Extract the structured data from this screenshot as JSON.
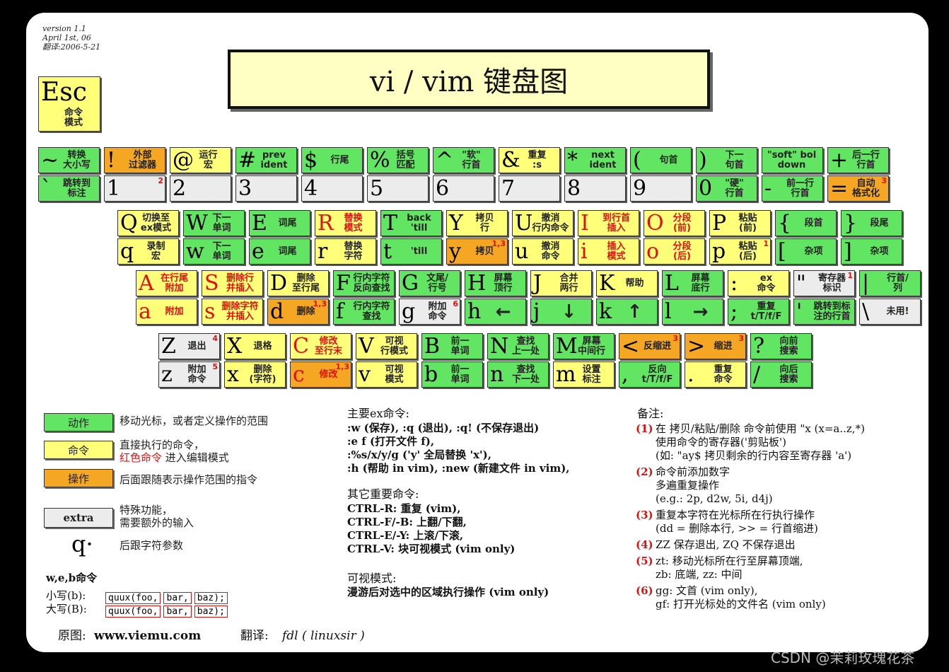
{
  "meta": {
    "version": "version 1.1",
    "date": "April 1st, 06",
    "translated": "翻译:2006-5-21"
  },
  "title": "vi / vim 键盘图",
  "esc": {
    "char": "Esc",
    "desc": "命令\n模式"
  },
  "rows": [
    [
      {
        "up": {
          "c": "~",
          "d": "转换\n大小写",
          "k": "g"
        },
        "dn": {
          "c": "`",
          "d": "跳转到\n标注",
          "k": "g"
        }
      },
      {
        "up": {
          "c": "!",
          "d": "外部\n过滤器",
          "k": "o"
        },
        "dn": {
          "c": "1",
          "d": "",
          "k": "x",
          "n": "2"
        }
      },
      {
        "up": {
          "c": "@",
          "d": "运行\n宏",
          "k": "y"
        },
        "dn": {
          "c": "2",
          "d": "",
          "k": "x"
        }
      },
      {
        "up": {
          "c": "#",
          "d": "prev\nident",
          "k": "g"
        },
        "dn": {
          "c": "3",
          "d": "",
          "k": "x"
        }
      },
      {
        "up": {
          "c": "$",
          "d": "行尾",
          "k": "g"
        },
        "dn": {
          "c": "4",
          "d": "",
          "k": "x"
        }
      },
      {
        "up": {
          "c": "%",
          "d": "括号\n匹配",
          "k": "g"
        },
        "dn": {
          "c": "5",
          "d": "",
          "k": "x"
        }
      },
      {
        "up": {
          "c": "^",
          "d": "\"软\"\n行首",
          "k": "g"
        },
        "dn": {
          "c": "6",
          "d": "",
          "k": "x"
        }
      },
      {
        "up": {
          "c": "&",
          "d": "重复\n:s",
          "k": "y"
        },
        "dn": {
          "c": "7",
          "d": "",
          "k": "x"
        }
      },
      {
        "up": {
          "c": "*",
          "d": "next\nident",
          "k": "g"
        },
        "dn": {
          "c": "8",
          "d": "",
          "k": "x"
        }
      },
      {
        "up": {
          "c": "(",
          "d": "句首",
          "k": "g"
        },
        "dn": {
          "c": "9",
          "d": "",
          "k": "x"
        }
      },
      {
        "up": {
          "c": ")",
          "d": "下一\n句首",
          "k": "g"
        },
        "dn": {
          "c": "0",
          "d": "\"硬\"\n行首",
          "k": "g"
        }
      },
      {
        "up": {
          "c": "",
          "d": "\"soft\" bol\ndown",
          "k": "g"
        },
        "dn": {
          "c": "-",
          "d": "前一行\n行首",
          "k": "g"
        }
      },
      {
        "up": {
          "c": "+",
          "d": "后一行\n行首",
          "k": "g"
        },
        "dn": {
          "c": "=",
          "d": "自动\n格式化",
          "k": "o",
          "n": "3"
        }
      }
    ],
    [
      {
        "up": {
          "c": "Q",
          "d": "切换至\nex模式",
          "k": "y"
        },
        "dn": {
          "c": "q",
          "d": "录制\n宏",
          "k": "y"
        }
      },
      {
        "up": {
          "c": "W",
          "d": "下一\n单词",
          "k": "g"
        },
        "dn": {
          "c": "w",
          "d": "下一\n单词",
          "k": "g"
        }
      },
      {
        "up": {
          "c": "E",
          "d": "词尾",
          "k": "g"
        },
        "dn": {
          "c": "e",
          "d": "词尾",
          "k": "g"
        }
      },
      {
        "up": {
          "c": "R",
          "d": "替换\n模式",
          "k": "y",
          "r": true
        },
        "dn": {
          "c": "r",
          "d": "替换\n字符",
          "k": "y"
        }
      },
      {
        "up": {
          "c": "T",
          "d": "back\n'till",
          "k": "g"
        },
        "dn": {
          "c": "t",
          "d": "'till",
          "k": "g"
        }
      },
      {
        "up": {
          "c": "Y",
          "d": "拷贝\n行",
          "k": "y"
        },
        "dn": {
          "c": "y",
          "d": "拷贝",
          "k": "o",
          "n": "1,3"
        }
      },
      {
        "up": {
          "c": "U",
          "d": "撤消\n行内命令",
          "k": "y"
        },
        "dn": {
          "c": "u",
          "d": "撤消\n命令",
          "k": "y"
        }
      },
      {
        "up": {
          "c": "I",
          "d": "到行首\n插入",
          "k": "y",
          "r": true
        },
        "dn": {
          "c": "i",
          "d": "插入\n模式",
          "k": "y",
          "r": true
        }
      },
      {
        "up": {
          "c": "O",
          "d": "分段\n(前)",
          "k": "y",
          "r": true
        },
        "dn": {
          "c": "o",
          "d": "分段\n(后)",
          "k": "y",
          "r": true
        }
      },
      {
        "up": {
          "c": "P",
          "d": "粘贴\n(前)",
          "k": "y"
        },
        "dn": {
          "c": "p",
          "d": "粘贴\n(后)",
          "k": "y",
          "n": "1"
        }
      },
      {
        "up": {
          "c": "{",
          "d": "段首",
          "k": "g"
        },
        "dn": {
          "c": "[",
          "d": "杂项",
          "k": "g"
        }
      },
      {
        "up": {
          "c": "}",
          "d": "段尾",
          "k": "g"
        },
        "dn": {
          "c": "]",
          "d": "杂项",
          "k": "g"
        }
      }
    ],
    [
      {
        "up": {
          "c": "A",
          "d": "在行尾\n附加",
          "k": "y",
          "r": true
        },
        "dn": {
          "c": "a",
          "d": "附加",
          "k": "y",
          "r": true
        }
      },
      {
        "up": {
          "c": "S",
          "d": "删除行\n并插入",
          "k": "y",
          "r": true
        },
        "dn": {
          "c": "s",
          "d": "删除字符\n并插入",
          "k": "y",
          "r": true
        }
      },
      {
        "up": {
          "c": "D",
          "d": "删除\n至行尾",
          "k": "y"
        },
        "dn": {
          "c": "d",
          "d": "删除",
          "k": "o",
          "n": "1,3"
        }
      },
      {
        "up": {
          "c": "F",
          "d": "行内字符\n反向查找",
          "k": "g"
        },
        "dn": {
          "c": "f",
          "d": "行内字符\n查找",
          "k": "g"
        }
      },
      {
        "up": {
          "c": "G",
          "d": "文尾/\n行号",
          "k": "g"
        },
        "dn": {
          "c": "g",
          "d": "附加\n命令",
          "k": "x",
          "n": "6"
        }
      },
      {
        "up": {
          "c": "H",
          "d": "屏幕\n顶行",
          "k": "g"
        },
        "dn": {
          "c": "h",
          "d": "←",
          "k": "g"
        }
      },
      {
        "up": {
          "c": "J",
          "d": "合并\n两行",
          "k": "y"
        },
        "dn": {
          "c": "j",
          "d": "↓",
          "k": "g"
        }
      },
      {
        "up": {
          "c": "K",
          "d": "帮助",
          "k": "y"
        },
        "dn": {
          "c": "k",
          "d": "↑",
          "k": "g"
        }
      },
      {
        "up": {
          "c": "L",
          "d": "屏幕\n底行",
          "k": "g"
        },
        "dn": {
          "c": "l",
          "d": "→",
          "k": "g"
        }
      },
      {
        "up": {
          "c": ":",
          "d": "ex\n命令",
          "k": "y"
        },
        "dn": {
          "c": ";",
          "d": "重复\nt/T/f/F",
          "k": "g"
        }
      },
      {
        "up": {
          "c": "\"",
          "d": "寄存器\n标识",
          "k": "x",
          "n": "1"
        },
        "dn": {
          "c": "'",
          "d": "跳转到标\n注的行首",
          "k": "g"
        }
      },
      {
        "up": {
          "c": "|",
          "d": "行首/\n列",
          "k": "g"
        },
        "dn": {
          "c": "\\",
          "d": "未用!",
          "k": "x"
        }
      }
    ],
    [
      {
        "up": {
          "c": "Z",
          "d": "退出",
          "k": "x",
          "n": "4"
        },
        "dn": {
          "c": "z",
          "d": "附加\n命令",
          "k": "x",
          "n": "5"
        }
      },
      {
        "up": {
          "c": "X",
          "d": "退格",
          "k": "y"
        },
        "dn": {
          "c": "x",
          "d": "删除\n(字符)",
          "k": "y"
        }
      },
      {
        "up": {
          "c": "C",
          "d": "修改\n至行末",
          "k": "y",
          "r": true
        },
        "dn": {
          "c": "c",
          "d": "修改",
          "k": "o",
          "r": true,
          "n": "1,3"
        }
      },
      {
        "up": {
          "c": "V",
          "d": "可视\n行模式",
          "k": "y"
        },
        "dn": {
          "c": "v",
          "d": "可视\n模式",
          "k": "y"
        }
      },
      {
        "up": {
          "c": "B",
          "d": "前一\n单词",
          "k": "g"
        },
        "dn": {
          "c": "b",
          "d": "前一\n单词",
          "k": "g"
        }
      },
      {
        "up": {
          "c": "N",
          "d": "查找\n上一处",
          "k": "g"
        },
        "dn": {
          "c": "n",
          "d": "查找\n下一处",
          "k": "g"
        }
      },
      {
        "up": {
          "c": "M",
          "d": "屏幕\n中间行",
          "k": "g"
        },
        "dn": {
          "c": "m",
          "d": "设置\n标注",
          "k": "y"
        }
      },
      {
        "up": {
          "c": "<",
          "d": "反缩进",
          "k": "o",
          "n": "3"
        },
        "dn": {
          "c": ",",
          "d": "反向\nt/T/f/F",
          "k": "g"
        }
      },
      {
        "up": {
          "c": ">",
          "d": "缩进",
          "k": "o",
          "n": "3"
        },
        "dn": {
          "c": ".",
          "d": "重复\n命令",
          "k": "y"
        }
      },
      {
        "up": {
          "c": "?",
          "d": "向前\n搜索",
          "k": "g"
        },
        "dn": {
          "c": "/",
          "d": "向后\n搜索",
          "k": "g"
        }
      }
    ]
  ],
  "legend": {
    "action": {
      "label": "动作",
      "desc": "移动光标，或者定义操作的范围"
    },
    "command": {
      "label": "命令",
      "desc1": "直接执行的命令，",
      "desc2_red": "红色命令",
      "desc2_rest": " 进入编辑模式"
    },
    "operation": {
      "label": "操作",
      "desc": "后面跟随表示操作范围的指令"
    },
    "extra": {
      "label": "extra",
      "desc": "特殊功能，\n需要额外的输入"
    },
    "char": {
      "label": "q·",
      "desc": "后跟字符参数"
    }
  },
  "web": {
    "title": "w,e,b命令",
    "lower_label": "小写(b):",
    "upper_label": "大写(B):",
    "lower_tokens": [
      "quux(foo,",
      "bar,",
      "baz);"
    ],
    "upper_tokens": [
      "quux(foo,",
      "bar,",
      "baz);"
    ]
  },
  "footer": {
    "source_label": "原图:",
    "source": "www.viemu.com",
    "trans_label": "翻译:",
    "trans": "fdl ( linuxsir )"
  },
  "ex": {
    "title": "主要ex命令:",
    "lines": [
      ":w (保存), :q (退出), :q! (不保存退出)",
      ":e f (打开文件 f),",
      ":%s/x/y/g ('y' 全局替换 'x'),",
      ":h (帮助 in vim), :new (新建文件 in vim),"
    ]
  },
  "other": {
    "title": "其它重要命令:",
    "lines": [
      "CTRL-R: 重复 (vim),",
      "CTRL-F/-B: 上翻/下翻,",
      "CTRL-E/-Y: 上滚/下滚,",
      "CTRL-V: 块可视模式 (vim only)"
    ]
  },
  "visual": {
    "title": "可视模式:",
    "line": "漫游后对选中的区域执行操作 (vim only)"
  },
  "notes": {
    "title": "备注:",
    "items": [
      {
        "n": "(1)",
        "lines": [
          "在 拷贝/粘贴/删除 命令前使用 \"x (x=a..z,*)",
          "使用命令的寄存器('剪贴板')",
          "(如: \"ay$ 拷贝剩余的行内容至寄存器 'a')"
        ]
      },
      {
        "n": "(2)",
        "lines": [
          "命令前添加数字",
          "多遍重复操作",
          "(e.g.: 2p, d2w, 5i, d4j)"
        ]
      },
      {
        "n": "(3)",
        "lines": [
          "重复本字符在光标所在行执行操作",
          "(dd = 删除本行, >> = 行首缩进)"
        ]
      },
      {
        "n": "(4)",
        "lines": [
          "ZZ 保存退出, ZQ 不保存退出"
        ]
      },
      {
        "n": "(5)",
        "lines": [
          "zt: 移动光标所在行至屏幕顶端,",
          "zb: 底端, zz: 中间"
        ]
      },
      {
        "n": "(6)",
        "lines": [
          "gg: 文首 (vim only),",
          "gf: 打开光标处的文件名 (vim only)"
        ]
      }
    ]
  },
  "watermark": "CSDN @茉莉玫瑰花茶"
}
